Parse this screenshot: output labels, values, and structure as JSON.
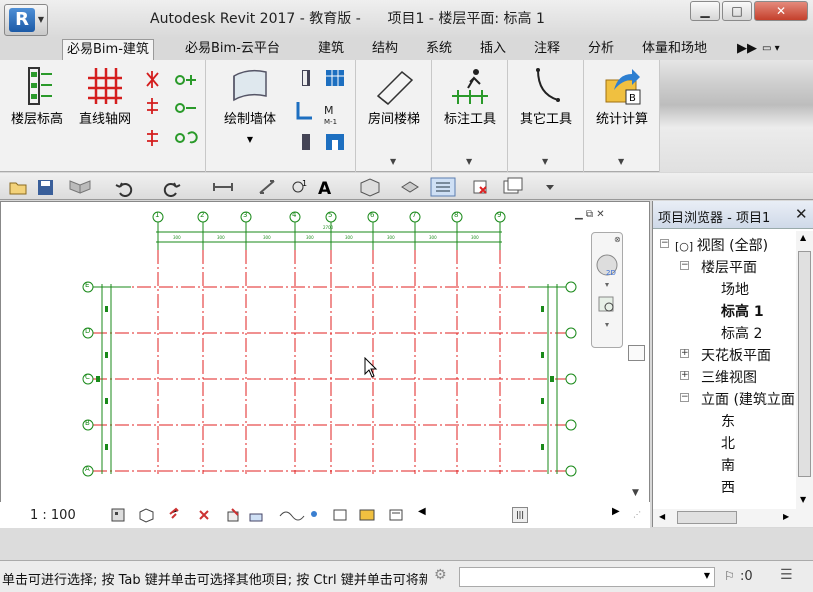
{
  "window": {
    "title": "Autodesk Revit 2017 - 教育版 -      项目1 - 楼层平面: 标高 1",
    "minimize": "▁",
    "maximize": "□",
    "close": "✕"
  },
  "app_button": {
    "letter": "R"
  },
  "tabs": [
    {
      "label": "必易Bim-建筑",
      "active": true
    },
    {
      "label": "必易Bim-云平台"
    },
    {
      "label": "建筑"
    },
    {
      "label": "结构"
    },
    {
      "label": "系统"
    },
    {
      "label": "插入"
    },
    {
      "label": "注释"
    },
    {
      "label": "分析"
    },
    {
      "label": "体量和场地"
    }
  ],
  "tab_overflow": "▶▶",
  "ribbon": {
    "level_btn": "楼层标高",
    "grid_btn": "直线轴网",
    "wall_btn": "绘制墙体",
    "room_btn": "房间楼梯",
    "annot_btn": "标注工具",
    "other_btn": "其它工具",
    "stat_btn": "统计计算"
  },
  "drawing": {
    "scale": "1 : 100",
    "grid_top": [
      "1",
      "2",
      "3",
      "4",
      "5",
      "6",
      "7",
      "8",
      "9"
    ],
    "grid_side": [
      "E",
      "D",
      "C",
      "B",
      "A"
    ]
  },
  "browser": {
    "title": "项目浏览器 - 项目1",
    "close": "✕",
    "nodes": {
      "views_all": "视图 (全部)",
      "floor_plans": "楼层平面",
      "site": "场地",
      "level1": "标高 1",
      "level2": "标高 2",
      "ceiling": "天花板平面",
      "view3d": "三维视图",
      "elevation": "立面 (建筑立面",
      "east": "东",
      "north": "北",
      "south": "南",
      "west": "西"
    }
  },
  "status": {
    "text": "单击可进行选择; 按 Tab 键并单击可选择其他项目; 按 Ctrl 键并单击可将新项目添加到选择集",
    "filter_count": ":0"
  }
}
